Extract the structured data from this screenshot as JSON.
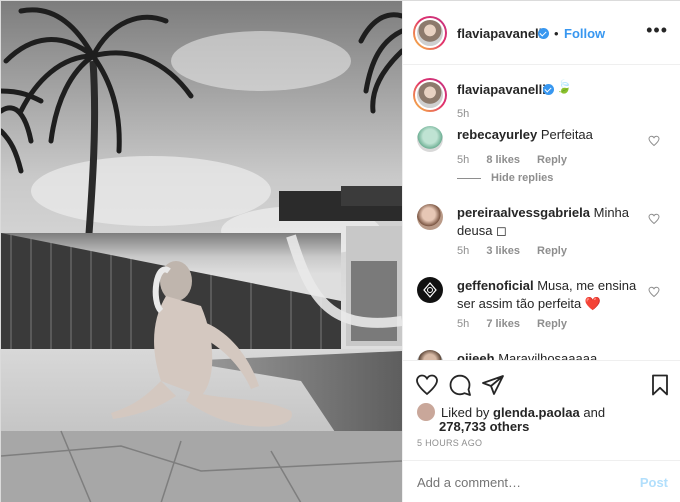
{
  "header": {
    "username": "flaviapavanelli",
    "separator": "•",
    "follow_label": "Follow",
    "more_icon": "more-options-icon",
    "more_label": "•••"
  },
  "caption": {
    "username": "flaviapavanelli",
    "emoji": "🍃",
    "time": "5h"
  },
  "comments": [
    {
      "username": "rebecayurley",
      "text": "Perfeitaa",
      "time": "5h",
      "likes": "8 likes",
      "reply": "Reply"
    },
    {
      "username": "pereiraalvessgabriela",
      "text": "Minha deusa ◻",
      "time": "5h",
      "likes": "3 likes",
      "reply": "Reply"
    },
    {
      "username": "geffenoficial",
      "text": "Musa, me ensina ser assim tão perfeita",
      "emoji": "❤️",
      "time": "5h",
      "likes": "7 likes",
      "reply": "Reply"
    },
    {
      "username": "ojjeeh",
      "text": "Maravilhosaaaaa"
    }
  ],
  "hide_replies_label": "Hide replies",
  "likes": {
    "prefix": "Liked by",
    "user": "glenda.paolaa",
    "joiner": "and",
    "others": "278,733 others"
  },
  "timestamp": "5 HOURS AGO",
  "add_comment": {
    "placeholder": "Add a comment…",
    "post_label": "Post"
  },
  "colors": {
    "accent": "#3897f0",
    "post_disabled": "#b2dffc",
    "muted": "#8e8e8e",
    "text": "#262626",
    "heart_red": "#ed4956"
  }
}
